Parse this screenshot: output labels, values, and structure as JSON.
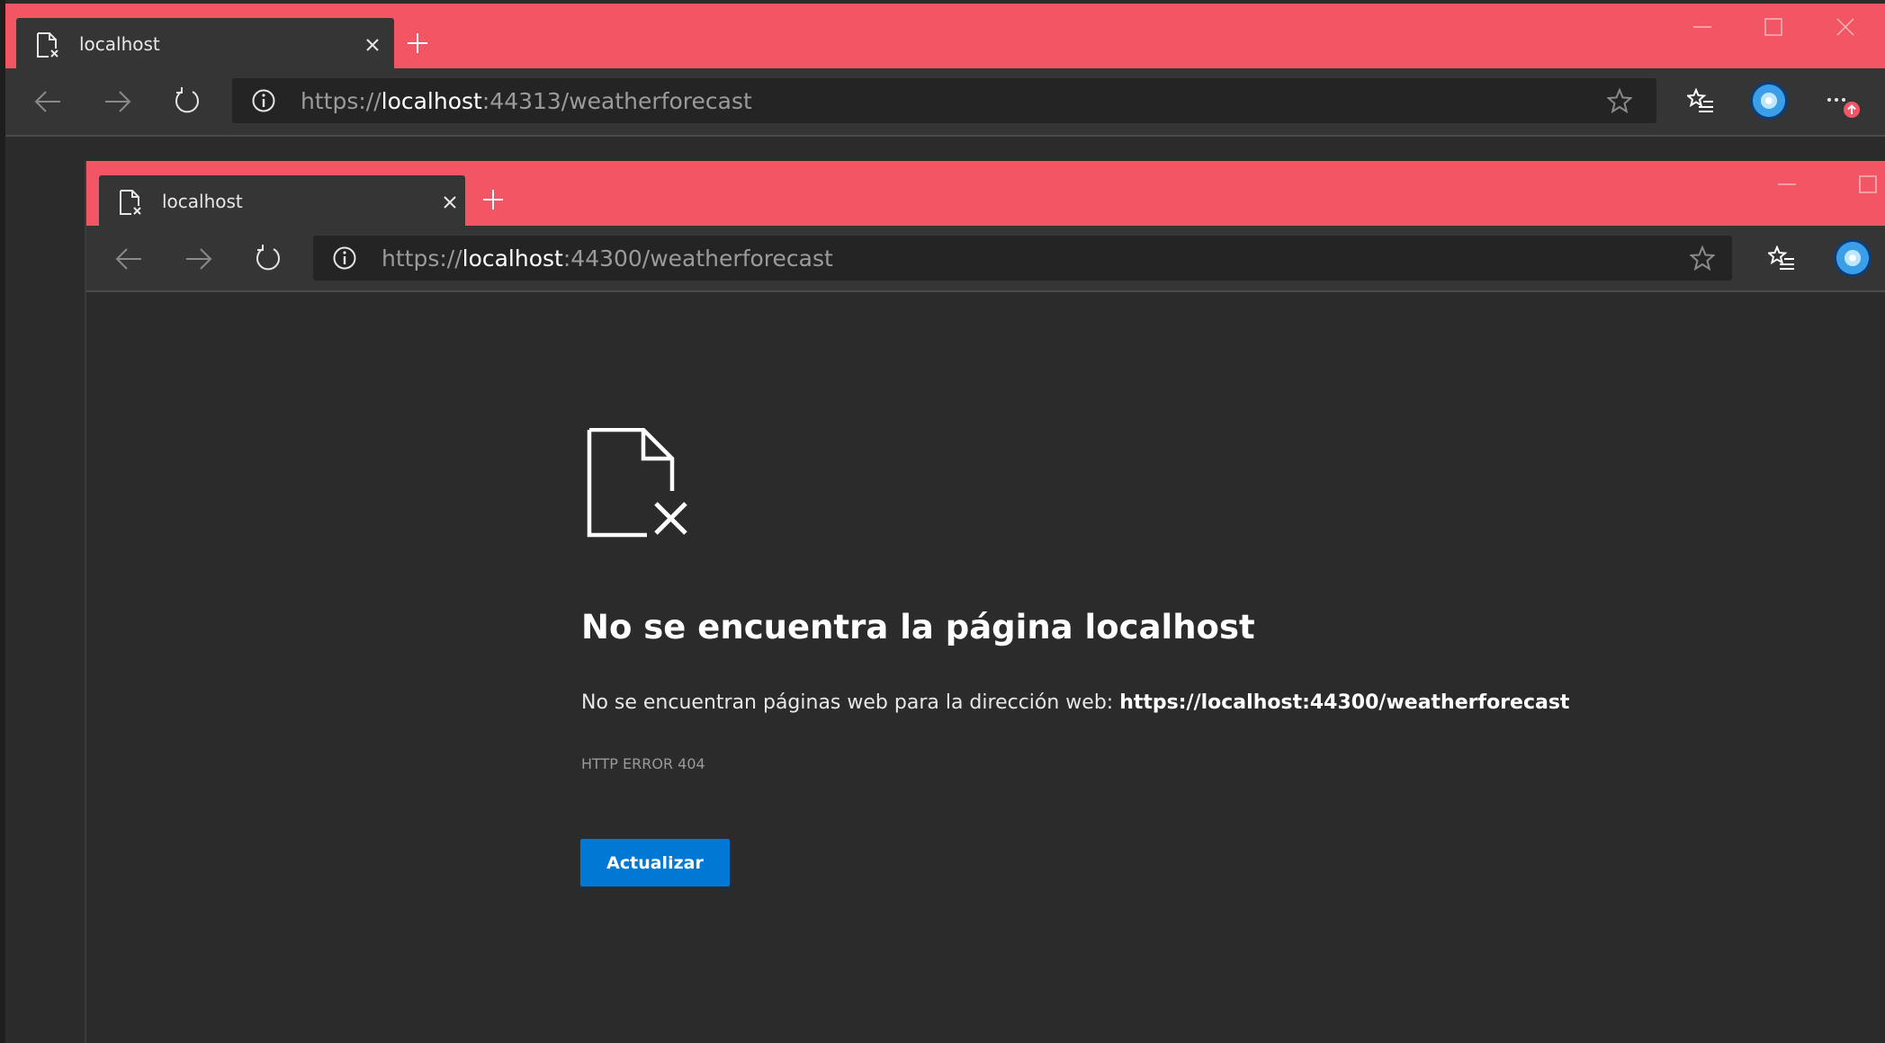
{
  "outer_window": {
    "tab": {
      "title": "localhost",
      "icon": "page-error-icon"
    },
    "new_tab": "+",
    "address": {
      "protocol": "https://",
      "host": "localhost",
      "rest": ":44313/weatherforecast"
    },
    "controls": [
      "minimize",
      "maximize",
      "close"
    ]
  },
  "inner_window": {
    "tab": {
      "title": "localhost",
      "icon": "page-error-icon"
    },
    "new_tab": "+",
    "address": {
      "protocol": "https://",
      "host": "localhost",
      "rest": ":44300/weatherforecast"
    },
    "controls": [
      "minimize",
      "maximize"
    ]
  },
  "error_page": {
    "title": "No se encuentra la página localhost",
    "description_prefix": "No se encuentran páginas web para la dirección web: ",
    "description_url": "https://localhost:44300/weatherforecast",
    "error_code": "HTTP ERROR 404",
    "refresh_button": "Actualizar"
  },
  "colors": {
    "tabstrip": "#f25563",
    "toolbar": "#353535",
    "page_background": "#2b2b2b",
    "button": "#0078d4"
  }
}
